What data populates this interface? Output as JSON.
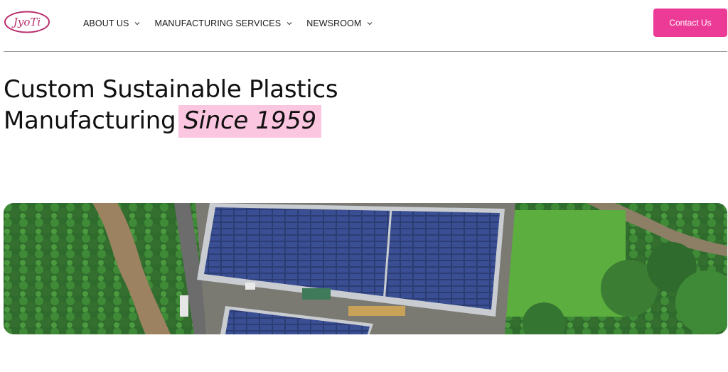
{
  "header": {
    "logo_text": "JyoTi",
    "nav": [
      {
        "label": "ABOUT US"
      },
      {
        "label": "MANUFACTURING SERVICES"
      },
      {
        "label": "NEWSROOM"
      }
    ],
    "cta_label": "Contact Us"
  },
  "hero": {
    "title_line1": "Custom Sustainable Plastics",
    "title_line2": "Manufacturing",
    "title_highlight": "Since 1959"
  },
  "colors": {
    "accent": "#ec3a97",
    "highlight": "#fbc6e0",
    "logo": "#b8306e"
  },
  "icons": [
    "chevron-down-icon",
    "jyoti-logo"
  ]
}
